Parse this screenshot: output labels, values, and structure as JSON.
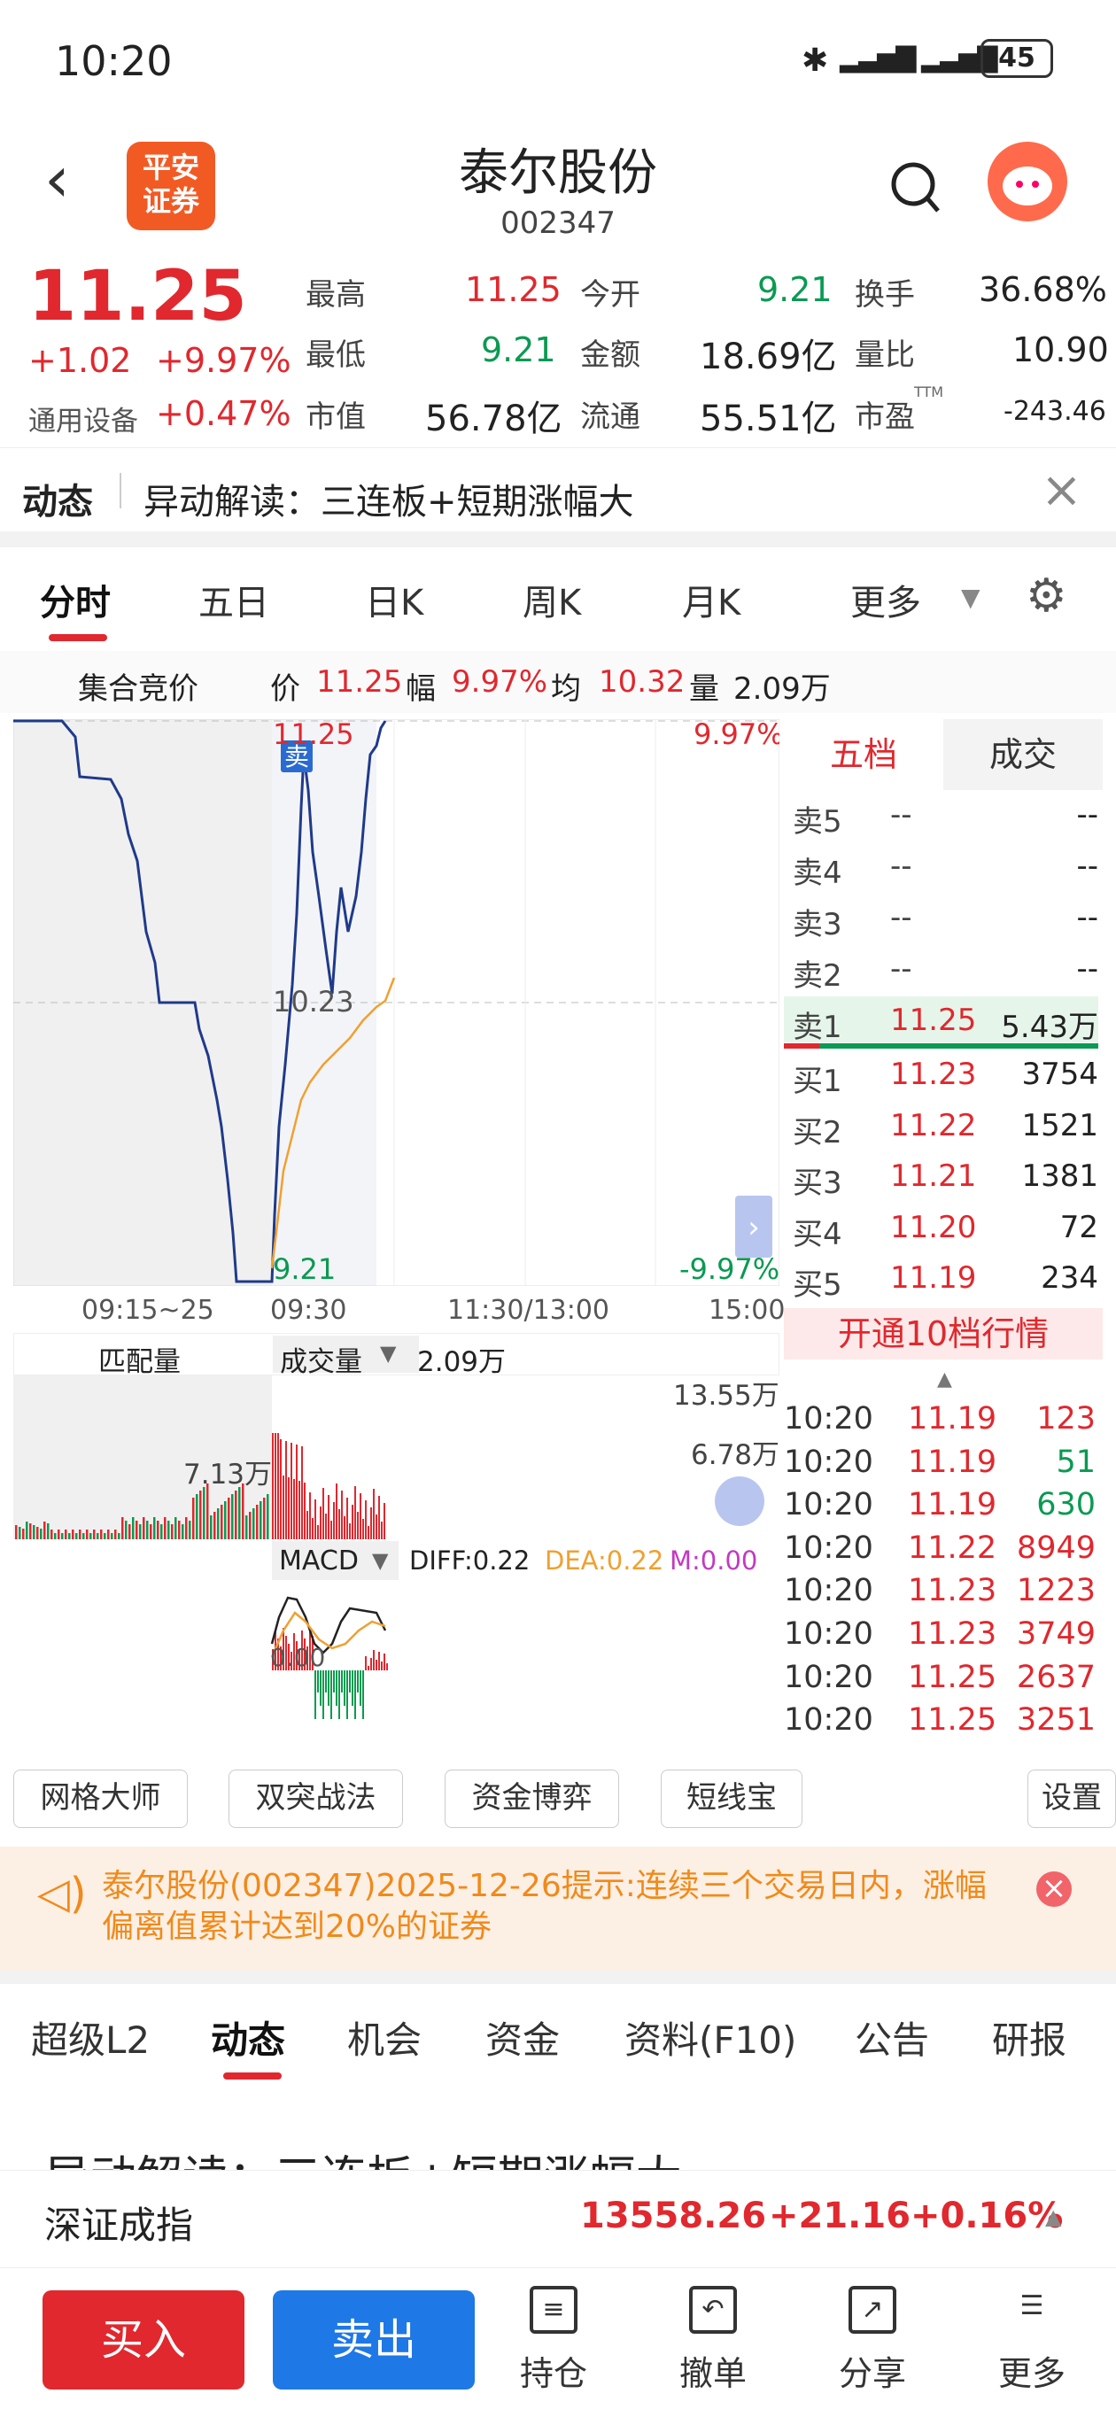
{
  "status": {
    "time": "10:20",
    "battery": "45"
  },
  "header": {
    "title": "泰尔股份",
    "code": "002347",
    "broker_logo": "平安\n证券",
    "back_icon": "chevron-left-icon",
    "search_icon": "search-icon"
  },
  "quote": {
    "price": "11.25",
    "change": "+1.02",
    "change_pct": "+9.97%",
    "sector_name": "通用设备",
    "sector_pct": "+0.47%",
    "high_label": "最高",
    "high": "11.25",
    "low_label": "最低",
    "low": "9.21",
    "mktcap_label": "市值",
    "mktcap": "56.78亿",
    "open_label": "今开",
    "open": "9.21",
    "amount_label": "金额",
    "amount": "18.69亿",
    "float_label": "流通",
    "float": "55.51亿",
    "turnover_label": "换手",
    "turnover": "36.68%",
    "volratio_label": "量比",
    "volratio": "10.90",
    "pe_label": "市盈",
    "pe_sup": "TTM",
    "pe": "-243.46"
  },
  "news": {
    "tag": "动态",
    "text": "异动解读：三连板+短期涨幅大"
  },
  "tabs": [
    "分时",
    "五日",
    "日K",
    "周K",
    "月K",
    "更多"
  ],
  "infoline": {
    "label": "集合竞价",
    "price_label": "价",
    "price": "11.25",
    "pct_label": "幅",
    "pct": "9.97%",
    "avg_label": "均",
    "avg": "10.32",
    "vol_label": "量",
    "vol": "2.09万"
  },
  "chart_labels": {
    "top": "11.25",
    "top_pct": "9.97%",
    "mid": "10.23",
    "bottom": "9.21",
    "bottom_pct": "-9.97%",
    "sell_marker": "卖"
  },
  "time_axis": [
    "09:15~25",
    "09:30",
    "11:30/13:00",
    "15:00"
  ],
  "volume": {
    "match_label": "匹配量",
    "vol_label": "成交量",
    "vol_value": "2.09万",
    "max": "13.55万",
    "mid": "6.78万",
    "auction_mark": "7.13万"
  },
  "macd": {
    "label": "MACD",
    "diff": "DIFF:0.22",
    "dea": "DEA:0.22",
    "m": "M:0.00",
    "zero": "0.00"
  },
  "orderbook": {
    "tab1": "五档",
    "tab2": "成交",
    "rows": [
      {
        "label": "卖5",
        "price": "--",
        "vol": "--"
      },
      {
        "label": "卖4",
        "price": "--",
        "vol": "--"
      },
      {
        "label": "卖3",
        "price": "--",
        "vol": "--"
      },
      {
        "label": "卖2",
        "price": "--",
        "vol": "--"
      },
      {
        "label": "卖1",
        "price": "11.25",
        "vol": "5.43万"
      },
      {
        "label": "买1",
        "price": "11.23",
        "vol": "3754"
      },
      {
        "label": "买2",
        "price": "11.22",
        "vol": "1521"
      },
      {
        "label": "买3",
        "price": "11.21",
        "vol": "1381"
      },
      {
        "label": "买4",
        "price": "11.20",
        "vol": "72"
      },
      {
        "label": "买5",
        "price": "11.19",
        "vol": "234"
      }
    ],
    "open10": "开通10档行情"
  },
  "ticks": [
    {
      "time": "10:20",
      "price": "11.19",
      "vol": "123",
      "dir": "sell"
    },
    {
      "time": "10:20",
      "price": "11.19",
      "vol": "51",
      "dir": "buy"
    },
    {
      "time": "10:20",
      "price": "11.19",
      "vol": "630",
      "dir": "buy"
    },
    {
      "time": "10:20",
      "price": "11.22",
      "vol": "8949",
      "dir": "sell"
    },
    {
      "time": "10:20",
      "price": "11.23",
      "vol": "1223",
      "dir": "sell"
    },
    {
      "time": "10:20",
      "price": "11.23",
      "vol": "3749",
      "dir": "sell"
    },
    {
      "time": "10:20",
      "price": "11.25",
      "vol": "2637",
      "dir": "sell"
    },
    {
      "time": "10:20",
      "price": "11.25",
      "vol": "3251",
      "dir": "sell"
    }
  ],
  "tools": [
    "网格大师",
    "双突战法",
    "资金博弈",
    "短线宝",
    "设置"
  ],
  "alert": {
    "text": "泰尔股份(002347)2025-12-26提示:连续三个交易日内，涨幅偏离值累计达到20%的证券"
  },
  "bottom_tabs": [
    "超级L2",
    "动态",
    "机会",
    "资金",
    "资料(F10)",
    "公告",
    "研报"
  ],
  "peek_text": "异动解读：三连板+短期涨幅大",
  "index": {
    "name": "深证成指",
    "value": "13558.26",
    "change": "+21.16",
    "pct": "+0.16%"
  },
  "actions": {
    "buy": "买入",
    "sell": "卖出",
    "hold": "持仓",
    "cancel": "撤单",
    "share": "分享",
    "more": "更多"
  },
  "colors": {
    "up": "#e0282e",
    "down": "#0a9a52",
    "brand": "#f25a24",
    "buy_btn": "#e0282e",
    "sell_btn": "#1e78e6",
    "price_line": "#1f3a8a",
    "avg_line": "#f0a030"
  }
}
